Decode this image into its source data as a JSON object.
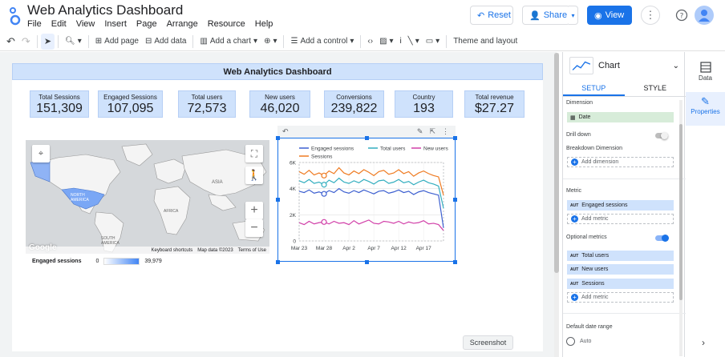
{
  "window": {
    "title": "Web Analytics Dashboard"
  },
  "menu": [
    "File",
    "Edit",
    "View",
    "Insert",
    "Page",
    "Arrange",
    "Resource",
    "Help"
  ],
  "header_buttons": {
    "reset": "Reset",
    "share": "Share",
    "view": "View"
  },
  "toolbar": {
    "add_page": "Add page",
    "add_data": "Add data",
    "add_chart": "Add a chart",
    "add_control": "Add a control",
    "theme_layout": "Theme and layout"
  },
  "report": {
    "header": "Web Analytics Dashboard",
    "scorecards": [
      {
        "label": "Total Sessions",
        "value": "151,309"
      },
      {
        "label": "Engaged Sessions",
        "value": "107,095"
      },
      {
        "label": "Total users",
        "value": "72,573"
      },
      {
        "label": "New users",
        "value": "46,020"
      },
      {
        "label": "Conversions",
        "value": "239,822"
      },
      {
        "label": "Country",
        "value": "193"
      },
      {
        "label": "Total revenue",
        "value": "$27.27"
      }
    ],
    "map": {
      "labels": {
        "north_america": "NORTH AMERICA",
        "south_america": "SOUTH AMERICA",
        "asia": "ASIA",
        "africa": "AFRICA"
      },
      "footer": {
        "shortcuts": "Keyboard shortcuts",
        "mapdata": "Map data ©2023",
        "terms": "Terms of Use"
      },
      "google": "Google",
      "legend": {
        "title": "Engaged sessions",
        "min": "0",
        "max": "39,979"
      }
    }
  },
  "chart_data": {
    "type": "line",
    "x": [
      "Mar 23",
      "Mar 24",
      "Mar 25",
      "Mar 26",
      "Mar 27",
      "Mar 28",
      "Mar 29",
      "Mar 30",
      "Mar 31",
      "Apr 1",
      "Apr 2",
      "Apr 3",
      "Apr 4",
      "Apr 5",
      "Apr 6",
      "Apr 7",
      "Apr 8",
      "Apr 9",
      "Apr 10",
      "Apr 11",
      "Apr 12",
      "Apr 13",
      "Apr 14",
      "Apr 15",
      "Apr 16",
      "Apr 17",
      "Apr 18",
      "Apr 19",
      "Apr 20",
      "Apr 21"
    ],
    "xticks": [
      "Mar 23",
      "Mar 28",
      "Apr 2",
      "Apr 7",
      "Apr 12",
      "Apr 17"
    ],
    "yticks": [
      "0",
      "2K",
      "4K",
      "6K"
    ],
    "ylim": [
      0,
      6000
    ],
    "series": [
      {
        "name": "Engaged sessions",
        "color": "#3c5fd0",
        "values": [
          3800,
          3700,
          3900,
          3650,
          3750,
          3600,
          3850,
          3700,
          4000,
          3750,
          3650,
          3850,
          3700,
          3900,
          3750,
          3600,
          3800,
          3850,
          3650,
          3750,
          3900,
          3700,
          3800,
          3550,
          3750,
          3850,
          3700,
          3600,
          3500,
          1000
        ]
      },
      {
        "name": "Total users",
        "color": "#33aebf",
        "values": [
          4600,
          4450,
          4700,
          4400,
          4500,
          4300,
          4650,
          4450,
          4800,
          4500,
          4400,
          4600,
          4450,
          4700,
          4550,
          4350,
          4600,
          4650,
          4400,
          4500,
          4700,
          4450,
          4550,
          4300,
          4500,
          4650,
          4450,
          4350,
          4200,
          2500
        ]
      },
      {
        "name": "New users",
        "color": "#d13fa8",
        "values": [
          1400,
          1250,
          1500,
          1300,
          1400,
          1450,
          1300,
          1500,
          1350,
          1400,
          1250,
          1550,
          1300,
          1450,
          1600,
          1350,
          1300,
          1500,
          1450,
          1350,
          1500,
          1300,
          1450,
          1350,
          1400,
          1550,
          1300,
          1350,
          1250,
          800
        ]
      },
      {
        "name": "Sessions",
        "color": "#ef7b22",
        "values": [
          5300,
          5100,
          5400,
          5050,
          5200,
          5000,
          5350,
          5150,
          5600,
          5200,
          5050,
          5350,
          5150,
          5450,
          5250,
          5000,
          5300,
          5400,
          5100,
          5200,
          5450,
          5150,
          5300,
          4950,
          5200,
          5350,
          5150,
          5000,
          4900,
          3500
        ]
      }
    ]
  },
  "panel": {
    "title": "Chart",
    "tabs": {
      "setup": "SETUP",
      "style": "STYLE"
    },
    "dimension_title": "Dimension",
    "dimension_value": "Date",
    "drill_down": "Drill down",
    "breakdown_title": "Breakdown Dimension",
    "add_dimension": "Add dimension",
    "metric_title": "Metric",
    "metric_value": "Engaged sessions",
    "add_metric": "Add metric",
    "optional_title": "Optional metrics",
    "optional_values": [
      "Total users",
      "New users",
      "Sessions"
    ],
    "aut": "AUT",
    "date_range_title": "Default date range",
    "date_range_option": "Auto"
  },
  "rail": {
    "data": "Data",
    "properties": "Properties"
  },
  "tooltip": "Screenshot",
  "colors": {
    "accent": "#1a73e8",
    "scorecard": "#cfe2fc",
    "dimension_chip": "#d7ecd9"
  }
}
